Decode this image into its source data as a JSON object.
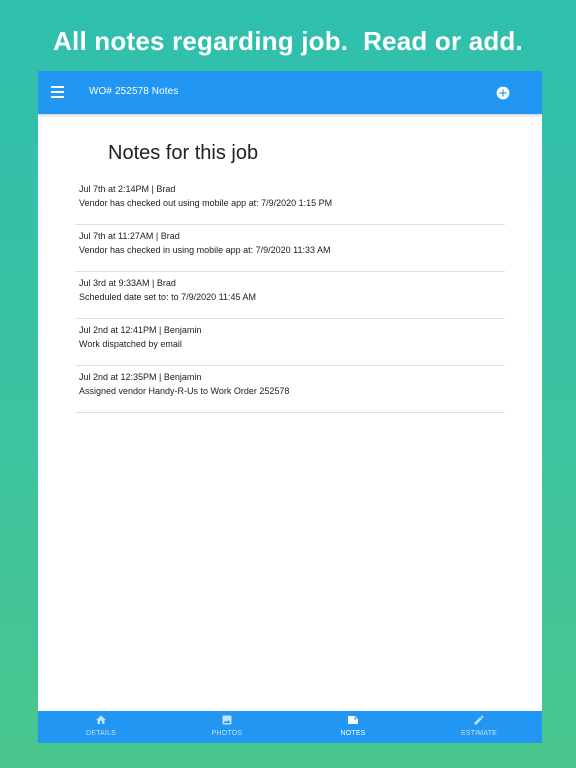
{
  "banner": {
    "text": "All notes regarding job.  Read or add."
  },
  "appbar": {
    "menu_icon": "hamburger-menu-icon",
    "title": "WO# 252578 Notes",
    "add_icon": "add-circle-icon"
  },
  "page": {
    "heading": "Notes for this job"
  },
  "notes": [
    {
      "meta": "Jul 7th at 2:14PM | Brad",
      "text": "Vendor has checked out using mobile app at: 7/9/2020 1:15 PM"
    },
    {
      "meta": "Jul 7th at 11:27AM | Brad",
      "text": "Vendor has checked in using mobile app at: 7/9/2020 11:33 AM"
    },
    {
      "meta": "Jul 3rd at 9:33AM | Brad",
      "text": "Scheduled date set to: to 7/9/2020 11:45 AM"
    },
    {
      "meta": "Jul 2nd at 12:41PM | Benjamin",
      "text": "Work dispatched by email"
    },
    {
      "meta": "Jul 2nd at 12:35PM | Benjamin",
      "text": "Assigned vendor Handy-R-Us to Work Order 252578"
    }
  ],
  "bottom_nav": {
    "items": [
      {
        "label": "DETAILS",
        "icon": "home-icon",
        "active": false
      },
      {
        "label": "PHOTOS",
        "icon": "image-icon",
        "active": false
      },
      {
        "label": "NOTES",
        "icon": "note-icon",
        "active": true
      },
      {
        "label": "ESTIMATE",
        "icon": "pencil-icon",
        "active": false
      }
    ]
  },
  "colors": {
    "background_top": "#2fbfae",
    "background_bottom": "#49c68d",
    "appbar": "#2196f3",
    "bottom_nav": "#2196f3",
    "text": "#212121",
    "divider": "#e0e0e0"
  }
}
